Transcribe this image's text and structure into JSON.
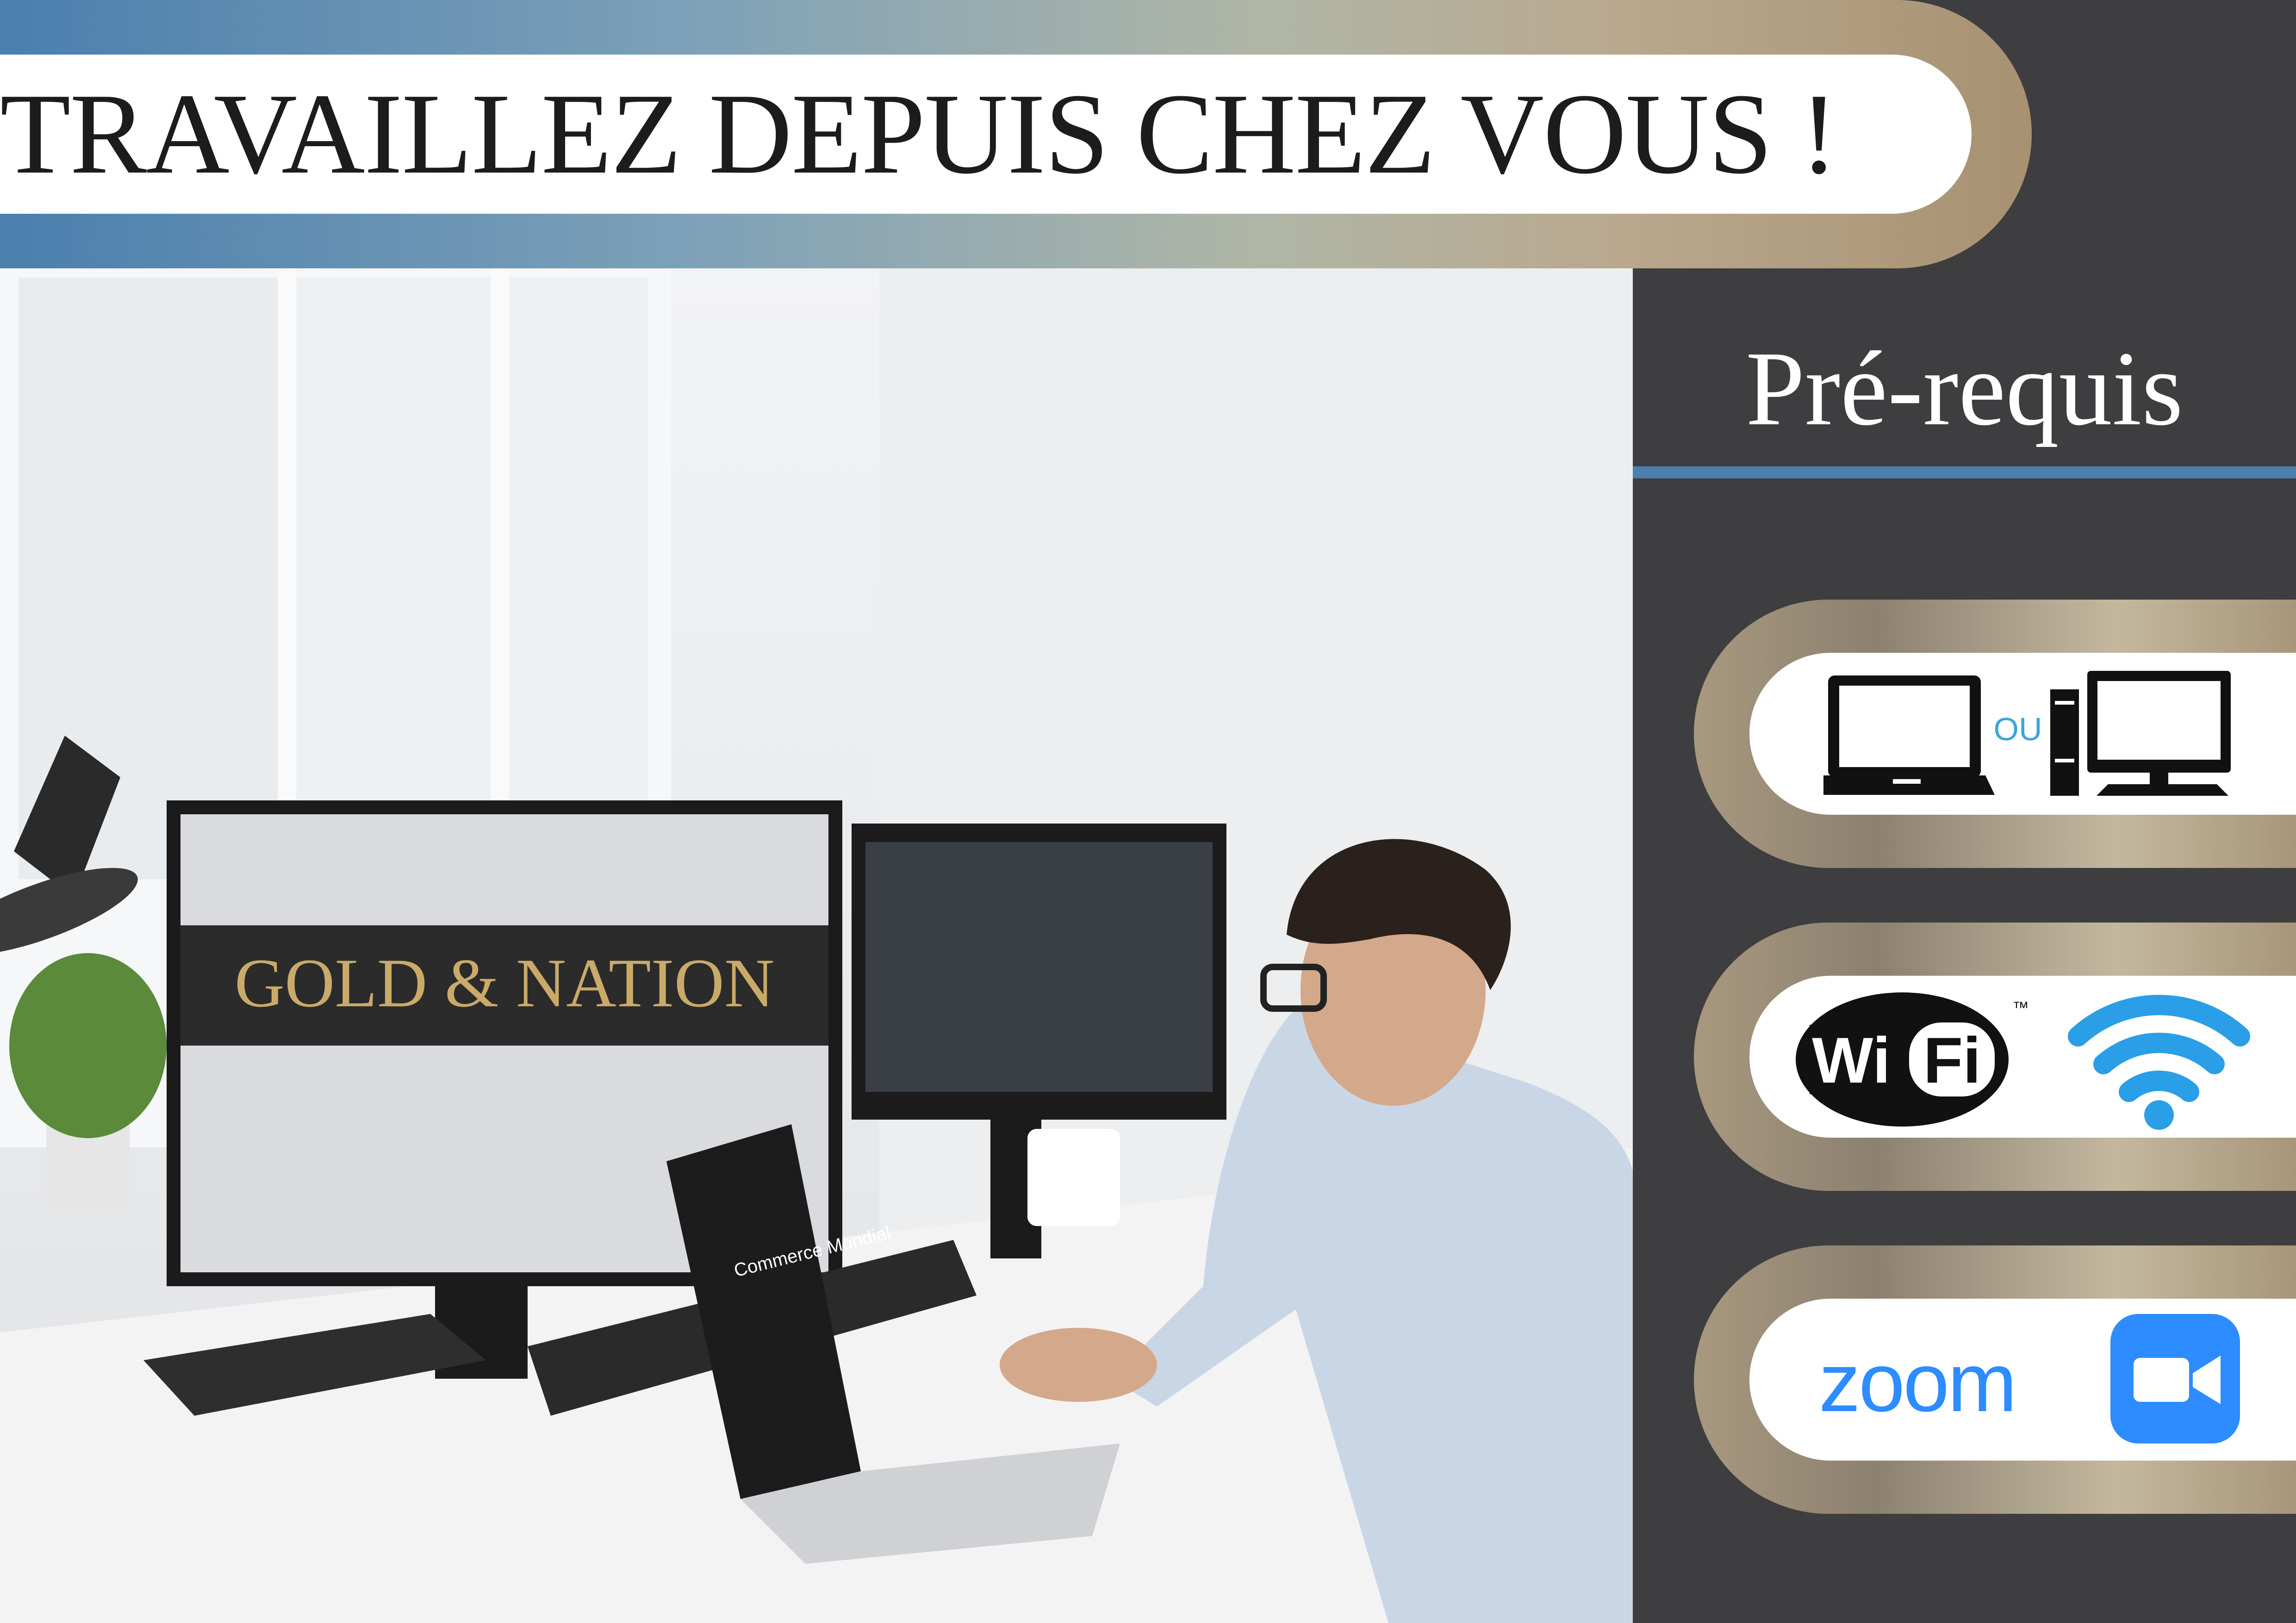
{
  "header": {
    "title": "TRAVAILLEZ DEPUIS CHEZ VOUS !"
  },
  "panel": {
    "title": "Pré-requis"
  },
  "requirements": [
    {
      "icons": [
        "laptop-icon",
        "desktop-computer-icon"
      ],
      "separator": "OU"
    },
    {
      "icons": [
        "wifi-logo-icon",
        "wifi-signal-icon"
      ],
      "wifi_logo_text_1": "Wi",
      "wifi_logo_text_2": "Fi",
      "trademark": "™"
    },
    {
      "icons": [
        "zoom-logo-icon",
        "video-camera-icon"
      ],
      "label": "zoom"
    }
  ],
  "photo": {
    "monitor_logo": "GOLD & NATION",
    "laptop_screen_text": "Commerce Mondial"
  },
  "colors": {
    "accent_blue": "#4a7fae",
    "gold": "#b9a88e",
    "panel_bg": "#3e3e40",
    "zoom_blue": "#2d8cff"
  }
}
